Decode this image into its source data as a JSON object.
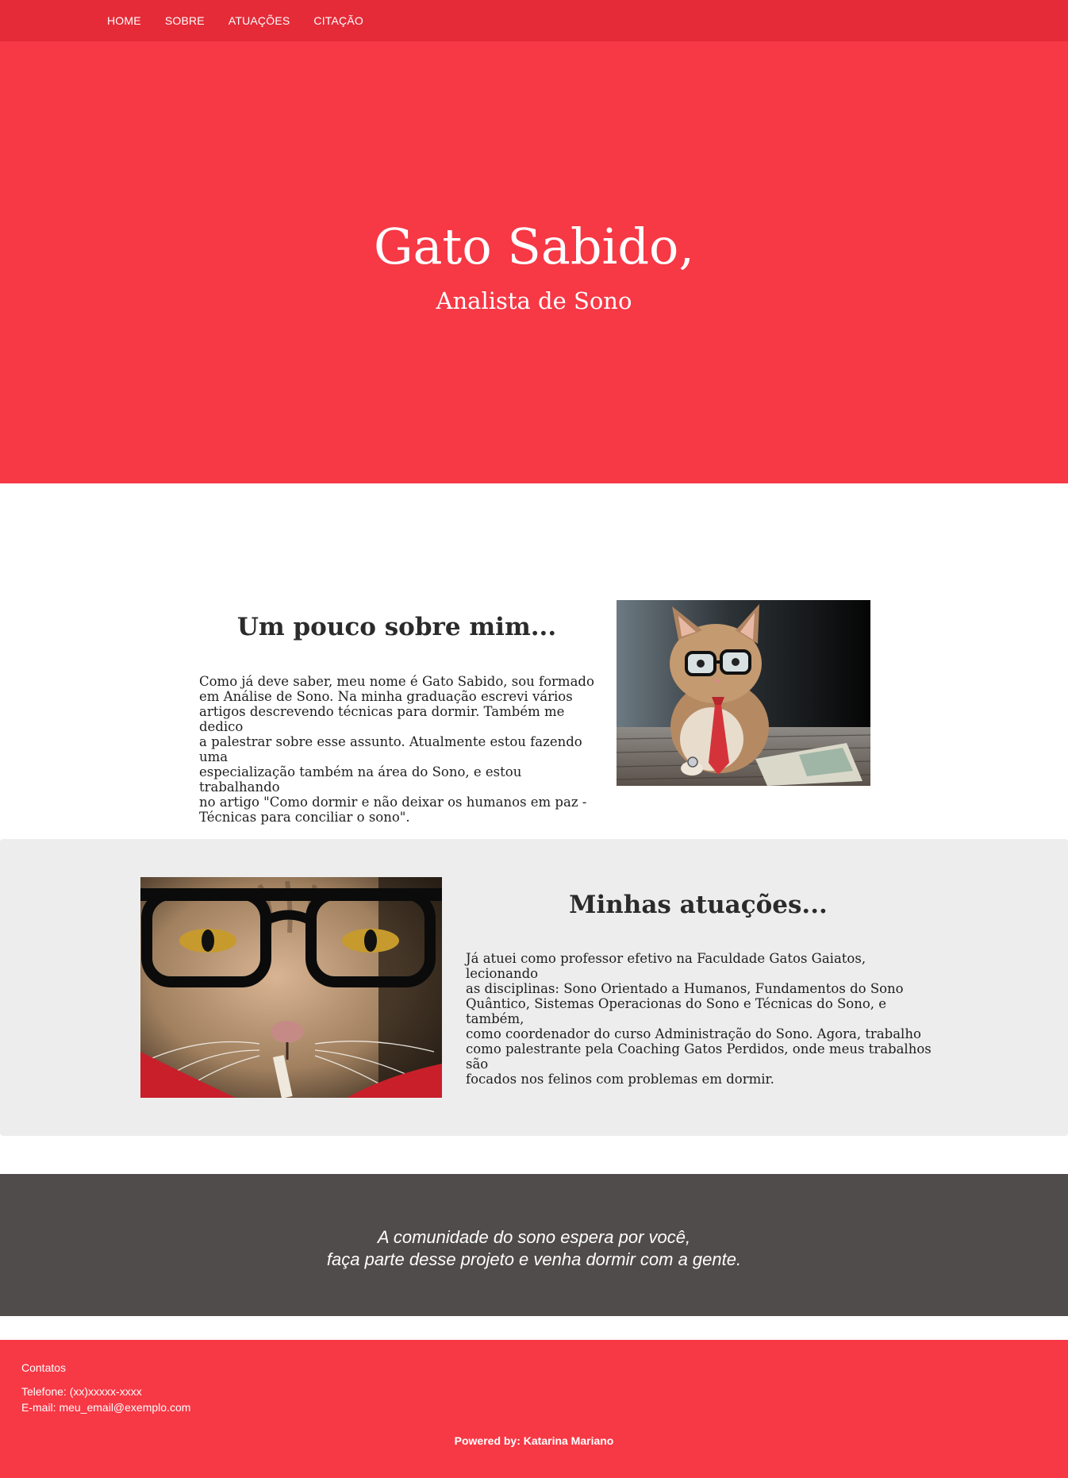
{
  "nav": {
    "items": [
      {
        "label": "HOME"
      },
      {
        "label": "SOBRE"
      },
      {
        "label": "ATUAÇÕES"
      },
      {
        "label": "CITAÇÃO"
      }
    ]
  },
  "hero": {
    "title": "Gato Sabido,",
    "subtitle": "Analista de Sono"
  },
  "about": {
    "title": "Um pouco sobre mim...",
    "paragraph_lines": [
      "Como já deve saber, meu nome é Gato Sabido, sou formado",
      "em Análise de Sono. Na minha graduação escrevi vários",
      "artigos descrevendo técnicas para dormir. Também me dedico",
      "a palestrar sobre esse assunto. Atualmente estou fazendo uma",
      "especialização também na área do Sono, e estou trabalhando",
      "no artigo \"Como dormir e não deixar os humanos em paz -",
      "Técnicas para conciliar o sono\"."
    ]
  },
  "atuacoes": {
    "title": "Minhas atuações...",
    "paragraph_lines": [
      "Já atuei como professor efetivo na Faculdade Gatos Gaiatos, lecionando",
      "as disciplinas: Sono Orientado a Humanos, Fundamentos do Sono",
      "Quântico, Sistemas Operacionas do Sono e Técnicas do Sono, e também,",
      "como coordenador do curso Administração do Sono. Agora, trabalho",
      "como palestrante pela Coaching Gatos Perdidos, onde meus trabalhos são",
      "focados nos felinos com problemas em dormir."
    ]
  },
  "citacao": {
    "line1": "A comunidade do sono espera por você,",
    "line2": "faça parte desse projeto e venha dormir com a gente."
  },
  "footer": {
    "contacts_heading": "Contatos",
    "phone": "Telefone: (xx)xxxxx-xxxx",
    "email": "E-mail: meu_email@exemplo.com",
    "powered_by": "Powered by: Katarina Mariano"
  },
  "colors": {
    "nav_bg": "#e52b38",
    "hero_bg": "#f73845",
    "section_gray": "#ededed",
    "quote_bg": "#504c4b",
    "footer_bg": "#f73845"
  }
}
